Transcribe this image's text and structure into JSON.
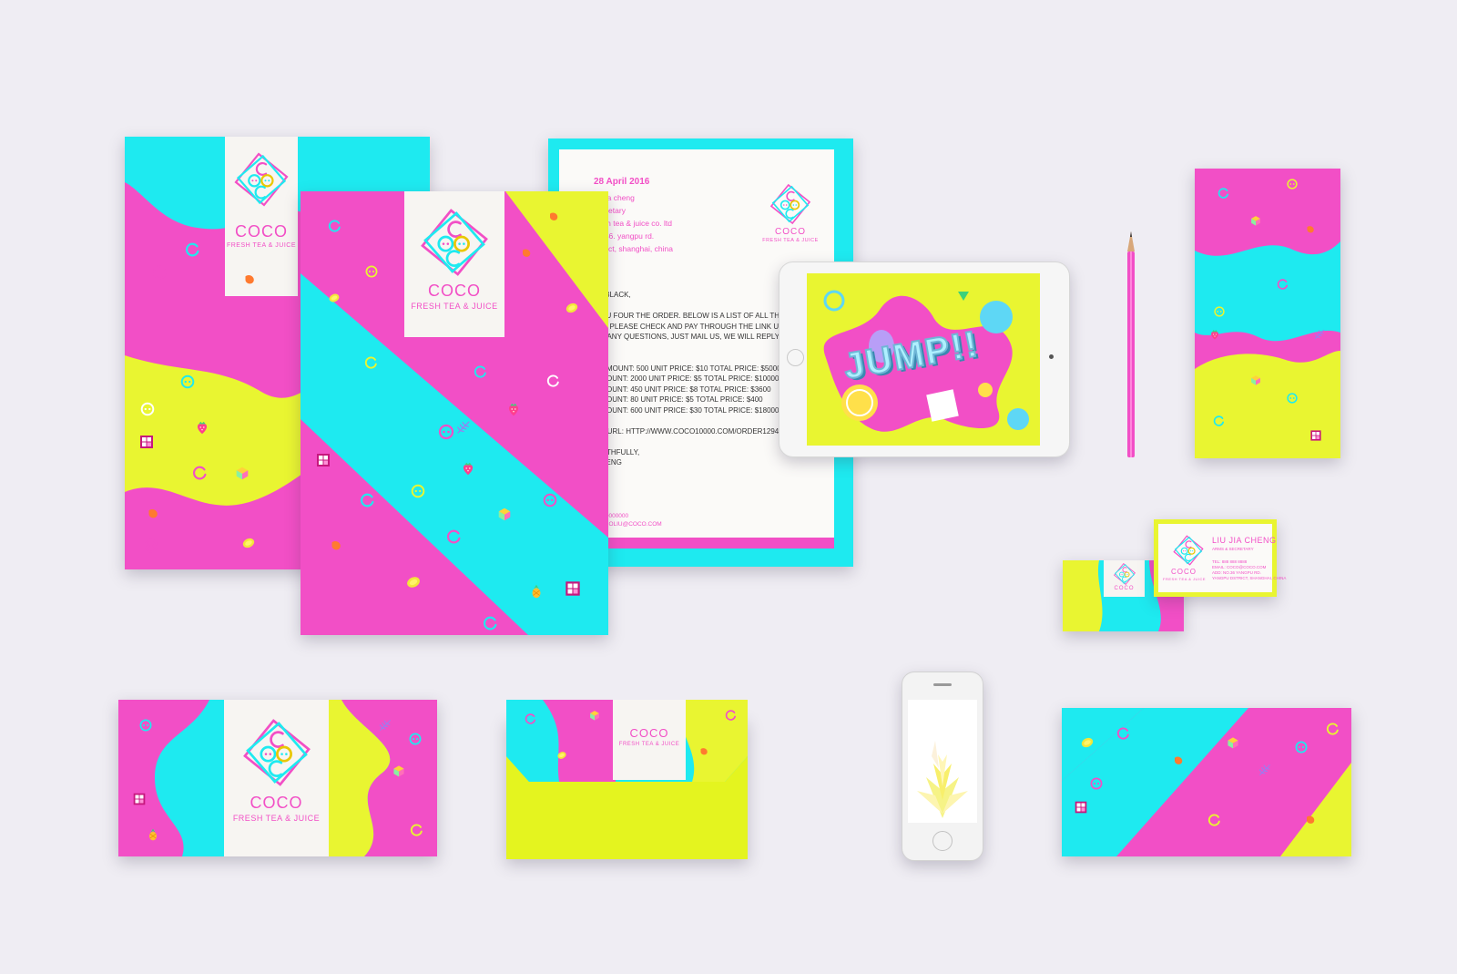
{
  "brand": {
    "name": "COCO",
    "tagline": "FRESH TEA & JUICE",
    "colors": {
      "magenta": "#f24fc6",
      "cyan": "#1eeaf0",
      "yellow": "#e9f531",
      "paper": "#f7f5f2",
      "background": "#efedf3"
    }
  },
  "letterhead": {
    "date": "28 April 2016",
    "recipient_lines": [
      "liu jia cheng",
      "secretary",
      "fresh tea & juice co. ltd",
      "no.36. yangpu rd.",
      "dstrict, shanghai, china"
    ],
    "body_lines": [
      "IR BLACK,",
      "",
      "YOU FOUR THE ORDER. BELOW IS A LIST OF ALL THE GO",
      "ED. PLEASE CHECK AND PAY THROUGH THE LINK UNDER",
      "VE ANY QUESTIONS, JUST MAIL US, WE WILL REPLY AS S",
      "LE.",
      "",
      "A    AMOUNT: 500   UNIT PRICE: $10    TOTAL PRICE: $5000",
      "     AMOUNT: 2000  UNIT PRICE: $5     TOTAL PRICE: $10000",
      "     AMOUNT: 450   UNIT PRICE: $8     TOTAL PRICE: $3600",
      "     AMOUNT: 80    UNIT PRICE: $5     TOTAL PRICE: $400",
      "     AMOUNT: 600   UNIT PRICE: $30    TOTAL PRICE: $18000",
      "",
      "NT URL: HTTP://WWW.COCO10000.COM/ORDER12943/PAY",
      "",
      "FAITHFULLY,",
      "CHENG"
    ],
    "footer_lines": [
      "8800000000",
      "COCOLIU@COCO.COM"
    ]
  },
  "tablet": {
    "screen_text": "JUMP!!"
  },
  "business_card": {
    "name": "LIU JIA CHENG",
    "title": "ARMS & SECRETARY",
    "details": [
      "TEL: 888 888 8888",
      "EMAIL: COCO@COCO.COM",
      "ADD: NO.36 YANGPU RD.",
      "YANGPU DSTRICT, SHANGHAI, CHINA"
    ]
  },
  "icons": [
    "coco-logo-icon",
    "pencil-icon",
    "strawberry-icon",
    "lemon-icon",
    "pineapple-icon",
    "leaf-icon",
    "chocolate-icon",
    "ring-icon"
  ]
}
